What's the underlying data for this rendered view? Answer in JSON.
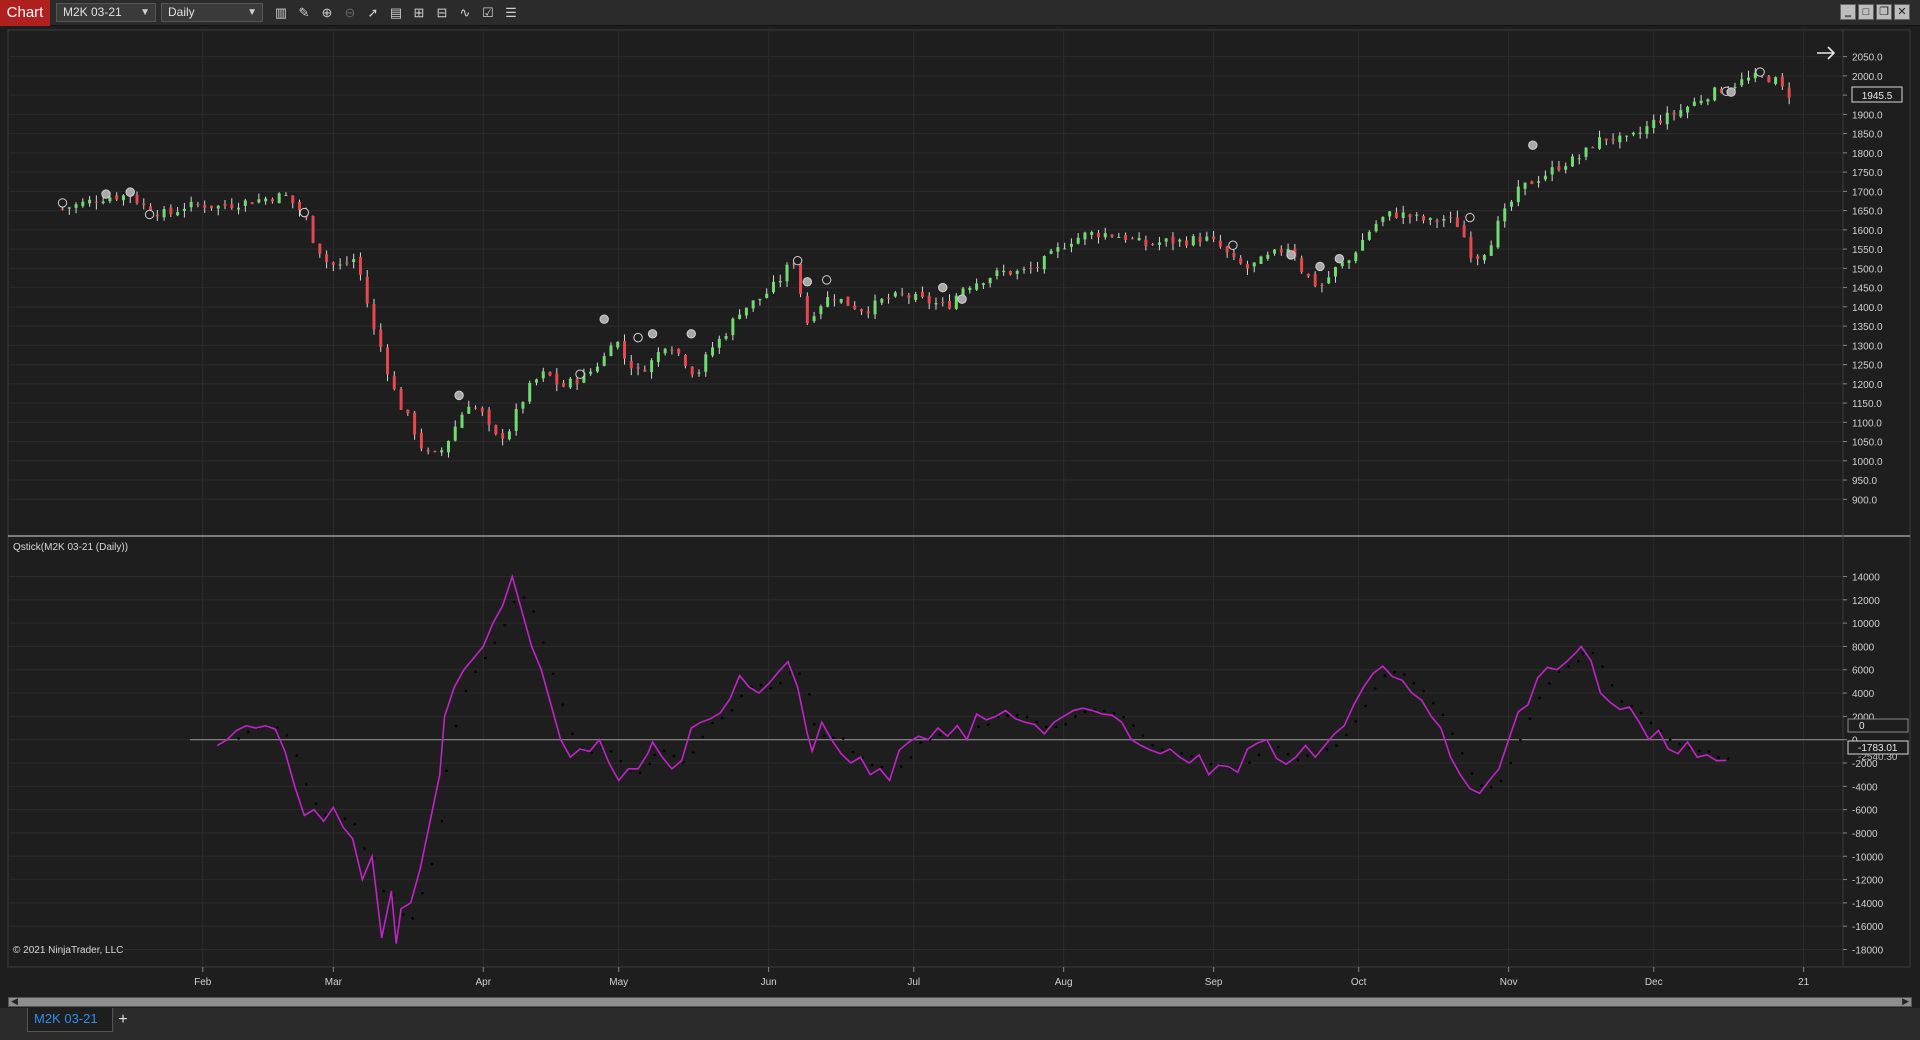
{
  "toolbar": {
    "chart_label": "Chart",
    "instrument": "M2K 03-21",
    "timeframe": "Daily",
    "icons": [
      "bar-type-icon",
      "drawing-tool-icon",
      "zoom-in-icon",
      "zoom-out-icon",
      "pointer-icon",
      "data-box-icon",
      "templates-icon",
      "strategies-icon",
      "indicators-icon",
      "properties-icon",
      "list-icon"
    ],
    "window_buttons": [
      "minimize-icon",
      "maximize-icon",
      "restore-icon",
      "close-icon"
    ]
  },
  "colors": {
    "background": "#1e1e1e",
    "grid": "#2c2c2c",
    "up_candle": "#6fdc6f",
    "down_candle": "#e8474c",
    "wick": "#d8d8d8",
    "qstick_line": "#c024c8",
    "qstick_dots": "#000000",
    "zero_line": "#8a8a8a",
    "scrollbar": "#8e8e8e",
    "tab_text": "#2f8ff0"
  },
  "chart": {
    "copyright": "© 2021 NinjaTrader, LLC",
    "indicator_label": "Qstick(M2K 03-21 (Daily))",
    "last_price_label": "1945.5",
    "qstick_value_label": "-1783.01",
    "qstick_secondary_label": "-2540.30",
    "zero_label": "0",
    "forward_arrow_icon": "arrow-right-icon"
  },
  "chart_data": [
    {
      "type": "candlestick",
      "title": "M2K 03-21 Daily",
      "y_ticks": [
        "2050.0",
        "2000.0",
        "1950.0",
        "1900.0",
        "1850.0",
        "1800.0",
        "1750.0",
        "1700.0",
        "1650.0",
        "1600.0",
        "1550.0",
        "1500.0",
        "1450.0",
        "1400.0",
        "1350.0",
        "1300.0",
        "1250.0",
        "1200.0",
        "1150.0",
        "1100.0",
        "1050.0",
        "1000.0",
        "950.0",
        "900.0"
      ],
      "ylim": [
        880,
        2075
      ],
      "x_ticks": [
        "Feb",
        "Mar",
        "Apr",
        "May",
        "Jun",
        "Jul",
        "Aug",
        "Sep",
        "Oct",
        "Nov",
        "Dec",
        "21"
      ],
      "x_tick_days": [
        35,
        62,
        93,
        121,
        152,
        182,
        213,
        244,
        274,
        305,
        335,
        366
      ],
      "x_range_days": [
        3,
        370
      ],
      "close_path": [
        [
          6,
          1655
        ],
        [
          15,
          1685
        ],
        [
          20,
          1690
        ],
        [
          24,
          1650
        ],
        [
          28,
          1640
        ],
        [
          31,
          1660
        ],
        [
          35,
          1665
        ],
        [
          38,
          1660
        ],
        [
          45,
          1675
        ],
        [
          52,
          1690
        ],
        [
          56,
          1640
        ],
        [
          58,
          1570
        ],
        [
          61,
          1510
        ],
        [
          64,
          1505
        ],
        [
          66,
          1530
        ],
        [
          68,
          1470
        ],
        [
          70,
          1350
        ],
        [
          72,
          1290
        ],
        [
          74,
          1200
        ],
        [
          76,
          1140
        ],
        [
          78,
          1100
        ],
        [
          80,
          1040
        ],
        [
          82,
          1010
        ],
        [
          84,
          1020
        ],
        [
          86,
          1060
        ],
        [
          88,
          1110
        ],
        [
          90,
          1150
        ],
        [
          93,
          1120
        ],
        [
          95,
          1060
        ],
        [
          98,
          1070
        ],
        [
          100,
          1130
        ],
        [
          103,
          1200
        ],
        [
          106,
          1230
        ],
        [
          109,
          1190
        ],
        [
          112,
          1210
        ],
        [
          115,
          1230
        ],
        [
          118,
          1270
        ],
        [
          120,
          1330
        ],
        [
          122,
          1270
        ],
        [
          125,
          1230
        ],
        [
          128,
          1260
        ],
        [
          131,
          1310
        ],
        [
          134,
          1270
        ],
        [
          137,
          1220
        ],
        [
          140,
          1290
        ],
        [
          143,
          1330
        ],
        [
          146,
          1390
        ],
        [
          150,
          1420
        ],
        [
          152,
          1440
        ],
        [
          155,
          1480
        ],
        [
          157,
          1530
        ],
        [
          158,
          1470
        ],
        [
          160,
          1360
        ],
        [
          162,
          1400
        ],
        [
          165,
          1430
        ],
        [
          168,
          1410
        ],
        [
          172,
          1390
        ],
        [
          176,
          1420
        ],
        [
          180,
          1430
        ],
        [
          183,
          1420
        ],
        [
          186,
          1410
        ],
        [
          189,
          1400
        ],
        [
          192,
          1450
        ],
        [
          196,
          1470
        ],
        [
          200,
          1490
        ],
        [
          204,
          1490
        ],
        [
          207,
          1500
        ],
        [
          210,
          1530
        ],
        [
          214,
          1570
        ],
        [
          218,
          1590
        ],
        [
          222,
          1590
        ],
        [
          226,
          1580
        ],
        [
          230,
          1560
        ],
        [
          234,
          1570
        ],
        [
          238,
          1570
        ],
        [
          242,
          1580
        ],
        [
          245,
          1560
        ],
        [
          248,
          1520
        ],
        [
          251,
          1500
        ],
        [
          254,
          1520
        ],
        [
          257,
          1540
        ],
        [
          260,
          1560
        ],
        [
          262,
          1500
        ],
        [
          264,
          1470
        ],
        [
          266,
          1450
        ],
        [
          268,
          1480
        ],
        [
          270,
          1510
        ],
        [
          272,
          1520
        ],
        [
          274,
          1560
        ],
        [
          277,
          1610
        ],
        [
          280,
          1640
        ],
        [
          283,
          1640
        ],
        [
          286,
          1630
        ],
        [
          289,
          1620
        ],
        [
          292,
          1630
        ],
        [
          295,
          1610
        ],
        [
          297,
          1540
        ],
        [
          299,
          1530
        ],
        [
          301,
          1560
        ],
        [
          303,
          1620
        ],
        [
          305,
          1660
        ],
        [
          307,
          1700
        ],
        [
          309,
          1720
        ],
        [
          312,
          1740
        ],
        [
          316,
          1770
        ],
        [
          320,
          1790
        ],
        [
          323,
          1830
        ],
        [
          326,
          1840
        ],
        [
          329,
          1830
        ],
        [
          332,
          1850
        ],
        [
          335,
          1880
        ],
        [
          339,
          1900
        ],
        [
          342,
          1920
        ],
        [
          346,
          1950
        ],
        [
          350,
          1970
        ],
        [
          354,
          1990
        ],
        [
          357,
          2000
        ],
        [
          360,
          1990
        ],
        [
          362,
          1960
        ],
        [
          364,
          1945
        ]
      ],
      "markers": "circles above/below price at selected swing points"
    },
    {
      "type": "line",
      "title": "Qstick(M2K 03-21 (Daily))",
      "y_ticks": [
        "14000",
        "12000",
        "10000",
        "8000",
        "6000",
        "4000",
        "2000",
        "0",
        "-2000",
        "-4000",
        "-6000",
        "-8000",
        "-10000",
        "-12000",
        "-14000",
        "-16000",
        "-18000"
      ],
      "ylim": [
        -19500,
        15500
      ],
      "series": [
        {
          "values": [
            [
              38,
              -500
            ],
            [
              40,
              0
            ],
            [
              42,
              800
            ],
            [
              44,
              1200
            ],
            [
              46,
              1000
            ],
            [
              48,
              1200
            ],
            [
              50,
              900
            ],
            [
              52,
              -1000
            ],
            [
              54,
              -4000
            ],
            [
              56,
              -6500
            ],
            [
              58,
              -6000
            ],
            [
              60,
              -7000
            ],
            [
              62,
              -5800
            ],
            [
              64,
              -7500
            ],
            [
              66,
              -8500
            ],
            [
              68,
              -12000
            ],
            [
              70,
              -10000
            ],
            [
              72,
              -17000
            ],
            [
              74,
              -13000
            ],
            [
              75,
              -17500
            ],
            [
              76,
              -14500
            ],
            [
              78,
              -14000
            ],
            [
              80,
              -11000
            ],
            [
              82,
              -7000
            ],
            [
              84,
              -3000
            ],
            [
              85,
              2000
            ],
            [
              87,
              4500
            ],
            [
              89,
              6000
            ],
            [
              91,
              7000
            ],
            [
              93,
              8000
            ],
            [
              95,
              10000
            ],
            [
              97,
              11500
            ],
            [
              99,
              14000
            ],
            [
              101,
              11000
            ],
            [
              103,
              8000
            ],
            [
              105,
              6000
            ],
            [
              107,
              3000
            ],
            [
              109,
              0
            ],
            [
              111,
              -1500
            ],
            [
              113,
              -800
            ],
            [
              115,
              -1000
            ],
            [
              117,
              0
            ],
            [
              119,
              -2000
            ],
            [
              121,
              -3500
            ],
            [
              123,
              -2500
            ],
            [
              125,
              -2500
            ],
            [
              127,
              -1200
            ],
            [
              128,
              -200
            ],
            [
              130,
              -1500
            ],
            [
              132,
              -2500
            ],
            [
              134,
              -1800
            ],
            [
              136,
              1000
            ],
            [
              138,
              1500
            ],
            [
              140,
              1800
            ],
            [
              142,
              2300
            ],
            [
              144,
              3500
            ],
            [
              146,
              5500
            ],
            [
              148,
              4500
            ],
            [
              150,
              4000
            ],
            [
              152,
              4800
            ],
            [
              154,
              5800
            ],
            [
              156,
              6700
            ],
            [
              158,
              4500
            ],
            [
              160,
              500
            ],
            [
              161,
              -1000
            ],
            [
              163,
              1500
            ],
            [
              165,
              0
            ],
            [
              167,
              -1200
            ],
            [
              169,
              -2000
            ],
            [
              171,
              -1500
            ],
            [
              173,
              -3000
            ],
            [
              175,
              -2500
            ],
            [
              177,
              -3500
            ],
            [
              179,
              -900
            ],
            [
              181,
              -200
            ],
            [
              183,
              300
            ],
            [
              185,
              0
            ],
            [
              187,
              1000
            ],
            [
              189,
              300
            ],
            [
              191,
              1200
            ],
            [
              193,
              0
            ],
            [
              195,
              2200
            ],
            [
              197,
              1700
            ],
            [
              199,
              2000
            ],
            [
              201,
              2500
            ],
            [
              203,
              1800
            ],
            [
              205,
              1500
            ],
            [
              207,
              1300
            ],
            [
              209,
              500
            ],
            [
              211,
              1500
            ],
            [
              213,
              2000
            ],
            [
              215,
              2500
            ],
            [
              217,
              2700
            ],
            [
              219,
              2500
            ],
            [
              221,
              2200
            ],
            [
              223,
              2100
            ],
            [
              225,
              1500
            ],
            [
              227,
              0
            ],
            [
              229,
              -500
            ],
            [
              231,
              -900
            ],
            [
              233,
              -1200
            ],
            [
              235,
              -800
            ],
            [
              237,
              -1500
            ],
            [
              239,
              -2000
            ],
            [
              241,
              -1300
            ],
            [
              243,
              -3000
            ],
            [
              245,
              -2200
            ],
            [
              247,
              -2300
            ],
            [
              249,
              -2800
            ],
            [
              251,
              -800
            ],
            [
              253,
              -300
            ],
            [
              255,
              0
            ],
            [
              257,
              -1600
            ],
            [
              259,
              -2100
            ],
            [
              261,
              -1500
            ],
            [
              263,
              -500
            ],
            [
              265,
              -1500
            ],
            [
              267,
              -500
            ],
            [
              269,
              500
            ],
            [
              271,
              1200
            ],
            [
              273,
              3000
            ],
            [
              275,
              4500
            ],
            [
              277,
              5700
            ],
            [
              279,
              6300
            ],
            [
              281,
              5400
            ],
            [
              283,
              5100
            ],
            [
              285,
              4000
            ],
            [
              287,
              3400
            ],
            [
              289,
              2000
            ],
            [
              291,
              1000
            ],
            [
              293,
              -1500
            ],
            [
              295,
              -3000
            ],
            [
              297,
              -4200
            ],
            [
              299,
              -4600
            ],
            [
              301,
              -3500
            ],
            [
              303,
              -2500
            ],
            [
              305,
              0
            ],
            [
              307,
              2400
            ],
            [
              309,
              3000
            ],
            [
              311,
              5300
            ],
            [
              313,
              6200
            ],
            [
              315,
              6000
            ],
            [
              317,
              6700
            ],
            [
              319,
              7500
            ],
            [
              320,
              8000
            ],
            [
              322,
              6800
            ],
            [
              324,
              4000
            ],
            [
              326,
              3200
            ],
            [
              328,
              2600
            ],
            [
              330,
              2800
            ],
            [
              332,
              1500
            ],
            [
              334,
              0
            ],
            [
              336,
              800
            ],
            [
              338,
              -800
            ],
            [
              340,
              -1200
            ],
            [
              342,
              -200
            ],
            [
              344,
              -1500
            ],
            [
              346,
              -1300
            ],
            [
              348,
              -1800
            ],
            [
              350,
              -1783
            ]
          ],
          "color": "#c024c8"
        }
      ]
    }
  ]
}
